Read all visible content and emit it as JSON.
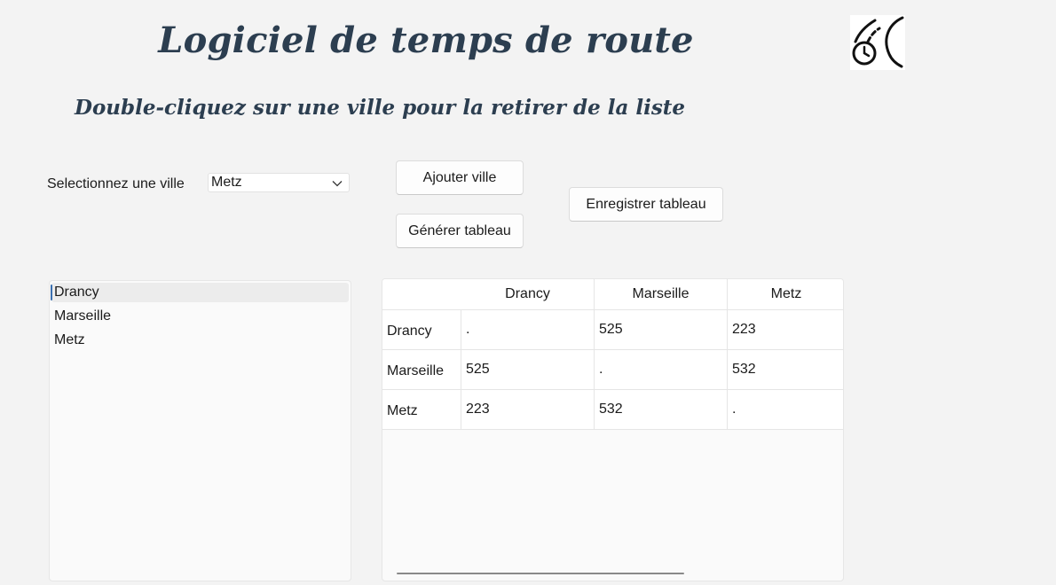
{
  "header": {
    "title": "Logiciel de temps de route",
    "subtitle": "Double-cliquez sur une ville pour la retirer de la liste",
    "logo_icon": "speedometer-road-icon"
  },
  "controls": {
    "select_label": "Selectionnez une ville",
    "city_select": {
      "selected": "Metz",
      "icon": "chevron-down-icon"
    },
    "add_button": "Ajouter ville",
    "generate_button": "Générer tableau",
    "save_button": "Enregistrer tableau"
  },
  "city_list": {
    "items": [
      "Drancy",
      "Marseille",
      "Metz"
    ],
    "selected_index": 0
  },
  "table": {
    "columns": [
      "Drancy",
      "Marseille",
      "Metz"
    ],
    "rows": [
      {
        "label": "Drancy",
        "values": [
          ".",
          "525",
          "223"
        ]
      },
      {
        "label": "Marseille",
        "values": [
          "525",
          ".",
          "532"
        ]
      },
      {
        "label": "Metz",
        "values": [
          "223",
          "532",
          "."
        ]
      }
    ]
  },
  "colors": {
    "title": "#2c3e50",
    "background": "#f3f3f3",
    "selection_accent": "#3a6fb0"
  }
}
